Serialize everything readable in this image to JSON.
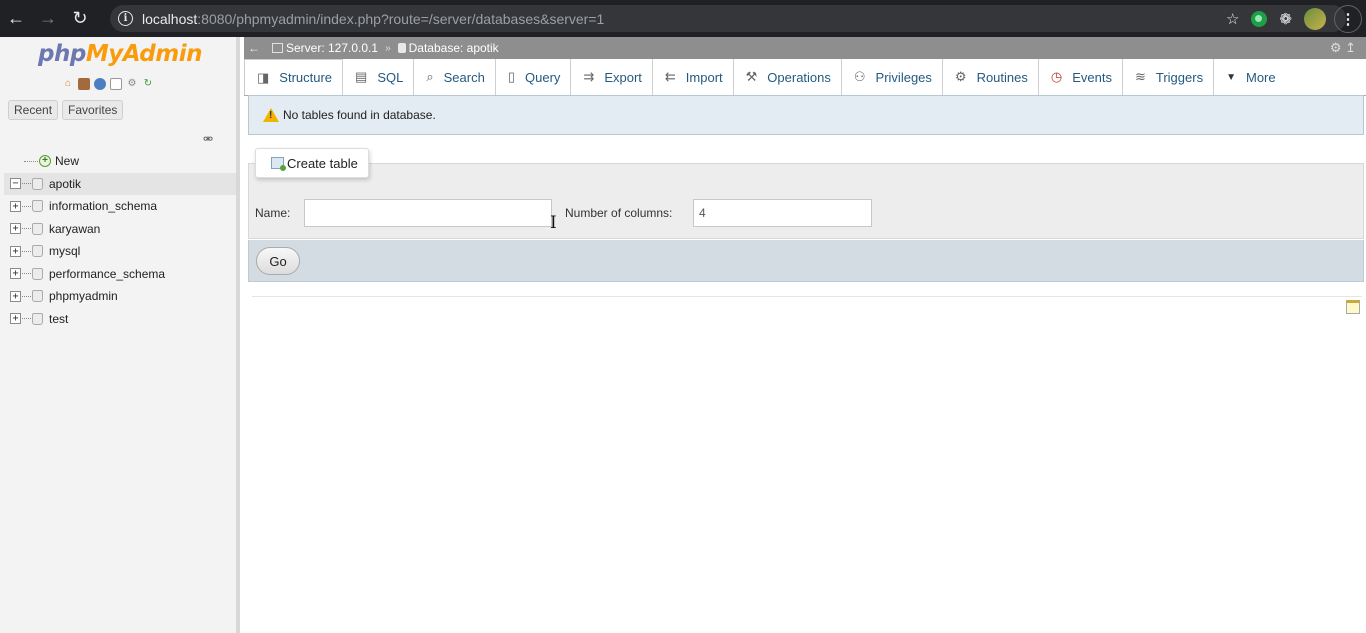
{
  "browser": {
    "url_host": "localhost",
    "url_rest": ":8080/phpmyadmin/index.php?route=/server/databases&server=1"
  },
  "sidebar": {
    "logo_php": "php",
    "logo_admin": "MyAdmin",
    "recent_label": "Recent",
    "favorites_label": "Favorites",
    "new_label": "New",
    "databases": [
      "apotik",
      "information_schema",
      "karyawan",
      "mysql",
      "performance_schema",
      "phpmyadmin",
      "test"
    ],
    "selected": "apotik"
  },
  "breadcrumb": {
    "server": "Server: 127.0.0.1",
    "database": "Database: apotik"
  },
  "tabs": [
    {
      "label": "Structure",
      "icon": "structure-icon",
      "glyph": "◨"
    },
    {
      "label": "SQL",
      "icon": "sql-icon",
      "glyph": "▤"
    },
    {
      "label": "Search",
      "icon": "search-icon",
      "glyph": "⌕"
    },
    {
      "label": "Query",
      "icon": "query-icon",
      "glyph": "▯"
    },
    {
      "label": "Export",
      "icon": "export-icon",
      "glyph": "⇉"
    },
    {
      "label": "Import",
      "icon": "import-icon",
      "glyph": "⇇"
    },
    {
      "label": "Operations",
      "icon": "wrench-icon",
      "glyph": "⚒"
    },
    {
      "label": "Privileges",
      "icon": "privileges-icon",
      "glyph": "⚇"
    },
    {
      "label": "Routines",
      "icon": "routines-icon",
      "glyph": "⚙"
    },
    {
      "label": "Events",
      "icon": "clock-icon",
      "glyph": "◷"
    },
    {
      "label": "Triggers",
      "icon": "triggers-icon",
      "glyph": "≋"
    },
    {
      "label": "More",
      "icon": "chevron-down-icon",
      "glyph": "▼"
    }
  ],
  "notice": {
    "text": "No tables found in database."
  },
  "create_table": {
    "legend": "Create table",
    "name_label": "Name:",
    "name_value": "",
    "columns_label": "Number of columns:",
    "columns_value": "4",
    "go_label": "Go"
  }
}
